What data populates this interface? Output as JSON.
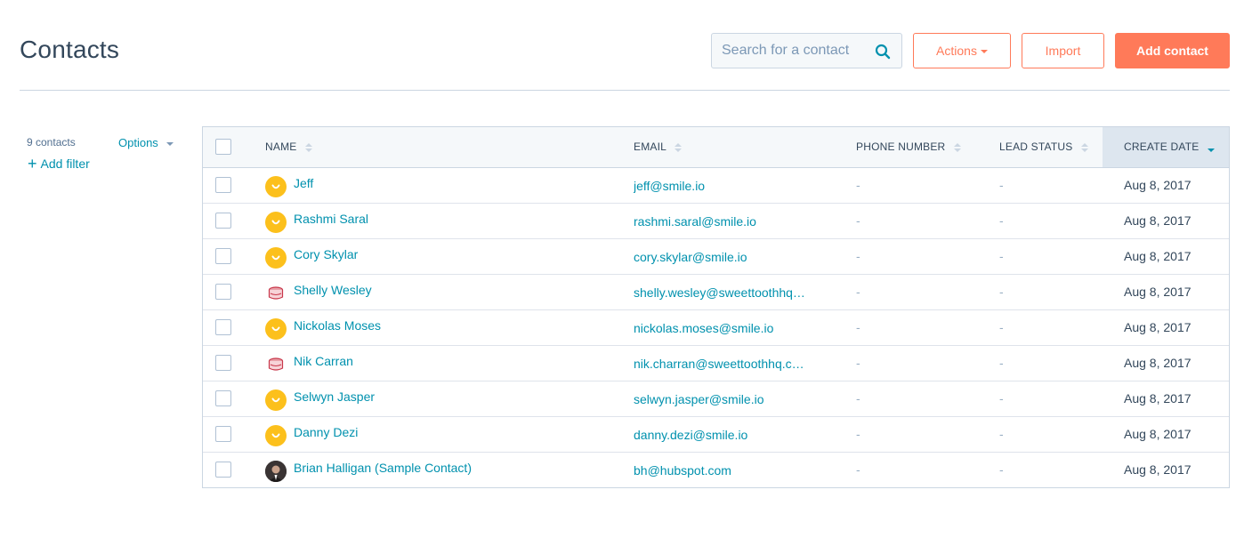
{
  "header": {
    "title": "Contacts",
    "search_placeholder": "Search for a contact",
    "actions_label": "Actions",
    "import_label": "Import",
    "add_contact_label": "Add contact"
  },
  "sidebar": {
    "count_label": "9 contacts",
    "options_label": "Options",
    "add_filter_label": "Add filter"
  },
  "table": {
    "columns": {
      "name": "NAME",
      "email": "EMAIL",
      "phone": "PHONE NUMBER",
      "lead_status": "LEAD STATUS",
      "create_date": "CREATE DATE"
    },
    "sorted_column": "create_date",
    "rows": [
      {
        "name": "Jeff",
        "avatar": "smile-logo-icon",
        "email": "jeff@smile.io",
        "phone": "-",
        "lead_status": "-",
        "create_date": "Aug 8, 2017"
      },
      {
        "name": "Rashmi Saral",
        "avatar": "smile-logo-icon",
        "email": "rashmi.saral@smile.io",
        "phone": "-",
        "lead_status": "-",
        "create_date": "Aug 8, 2017"
      },
      {
        "name": "Cory Skylar",
        "avatar": "smile-logo-icon",
        "email": "cory.skylar@smile.io",
        "phone": "-",
        "lead_status": "-",
        "create_date": "Aug 8, 2017"
      },
      {
        "name": "Shelly Wesley",
        "avatar": "sweettooth-logo-icon",
        "email": "shelly.wesley@sweettoothhq…",
        "phone": "-",
        "lead_status": "-",
        "create_date": "Aug 8, 2017"
      },
      {
        "name": "Nickolas Moses",
        "avatar": "smile-logo-icon",
        "email": "nickolas.moses@smile.io",
        "phone": "-",
        "lead_status": "-",
        "create_date": "Aug 8, 2017"
      },
      {
        "name": "Nik Carran",
        "avatar": "sweettooth-logo-icon",
        "email": "nik.charran@sweettoothhq.c…",
        "phone": "-",
        "lead_status": "-",
        "create_date": "Aug 8, 2017"
      },
      {
        "name": "Selwyn Jasper",
        "avatar": "smile-logo-icon",
        "email": "selwyn.jasper@smile.io",
        "phone": "-",
        "lead_status": "-",
        "create_date": "Aug 8, 2017"
      },
      {
        "name": "Danny Dezi",
        "avatar": "smile-logo-icon",
        "email": "danny.dezi@smile.io",
        "phone": "-",
        "lead_status": "-",
        "create_date": "Aug 8, 2017"
      },
      {
        "name": "Brian Halligan (Sample Contact)",
        "avatar": "person-photo-avatar",
        "email": "bh@hubspot.com",
        "phone": "-",
        "lead_status": "-",
        "create_date": "Aug 8, 2017"
      }
    ]
  },
  "colors": {
    "accent": "#ff7a59",
    "link": "#0091ae",
    "text": "#33475b",
    "border": "#cbd6e2",
    "smile_yellow": "#fcc01c",
    "sweettooth_red": "#c8374a"
  }
}
